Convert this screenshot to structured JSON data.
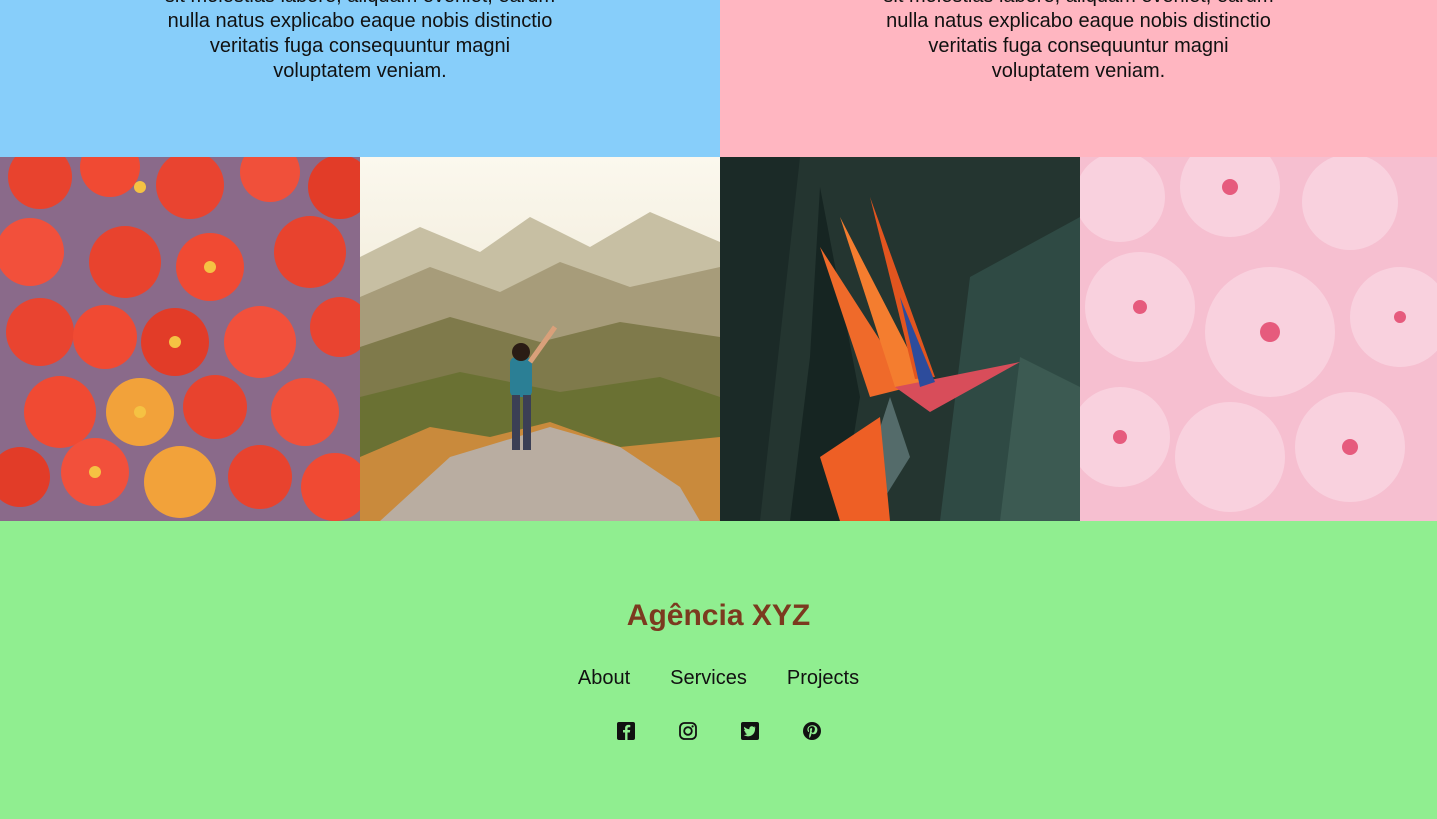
{
  "panels": [
    {
      "text": "sit molestias labore, aliquam eveniet, earum nulla natus explicabo eaque nobis distinctio veritatis fuga consequuntur magni voluptatem veniam.",
      "color": "#87cefa"
    },
    {
      "text": "sit molestias labore, aliquam eveniet, earum nulla natus explicabo eaque nobis distinctio veritatis fuga consequuntur magni voluptatem veniam.",
      "color": "#ffb6c1"
    }
  ],
  "gallery": [
    {
      "subject": "tomatoes"
    },
    {
      "subject": "hiker-mountains"
    },
    {
      "subject": "bird-of-paradise-flower"
    },
    {
      "subject": "pink-blossoms"
    }
  ],
  "footer": {
    "brand": "Agência XYZ",
    "nav": [
      "About",
      "Services",
      "Projects"
    ],
    "social_icons": [
      "facebook-icon",
      "instagram-icon",
      "twitter-icon",
      "pinterest-icon"
    ],
    "background": "#90ee90",
    "brand_color": "#7b3a1f"
  }
}
